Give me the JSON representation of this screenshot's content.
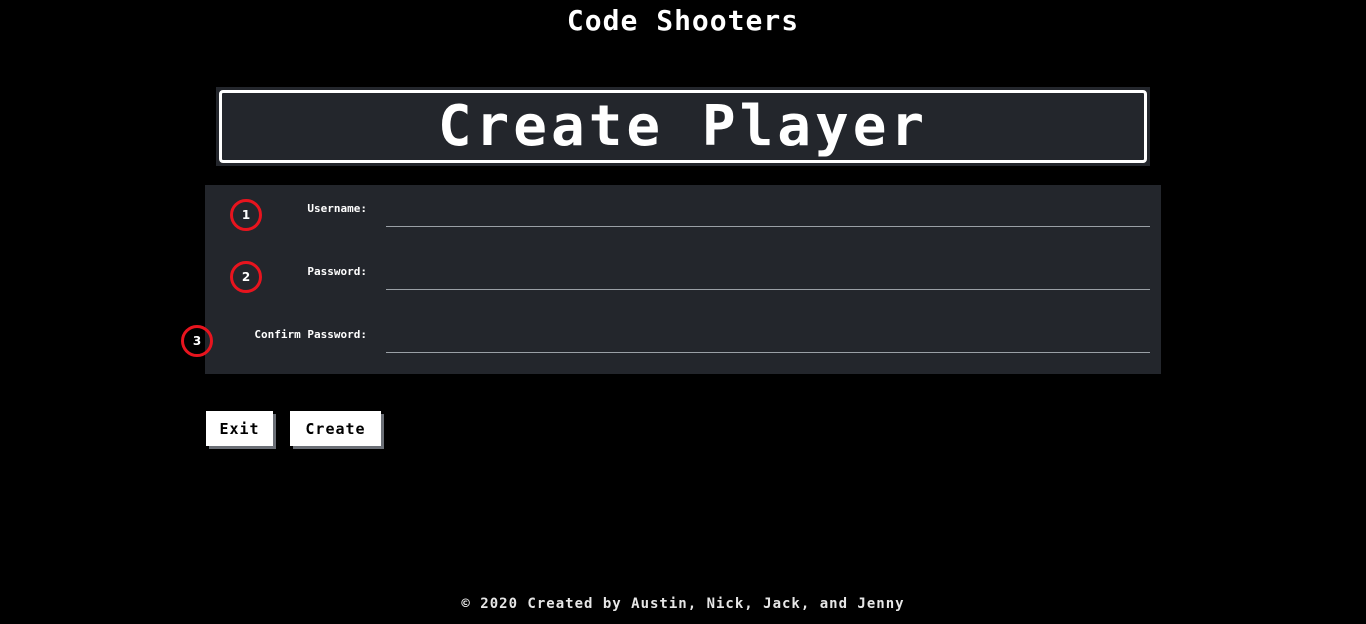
{
  "app": {
    "title": "Code Shooters"
  },
  "banner": {
    "title": "Create Player"
  },
  "form": {
    "fields": [
      {
        "marker": "1",
        "label": "Username:",
        "value": "",
        "placeholder": ""
      },
      {
        "marker": "2",
        "label": "Password:",
        "value": "",
        "placeholder": ""
      },
      {
        "marker": "3",
        "label": "Confirm Password:",
        "value": "",
        "placeholder": ""
      }
    ]
  },
  "buttons": {
    "exit_label": "Exit",
    "create_label": "Create"
  },
  "footer": {
    "text": "© 2020 Created by Austin, Nick, Jack, and Jenny"
  },
  "colors": {
    "background": "#000000",
    "panel": "#23262c",
    "marker_ring": "#e8141e",
    "button_bg": "#ffffff",
    "button_shadow": "#6b6f76"
  }
}
